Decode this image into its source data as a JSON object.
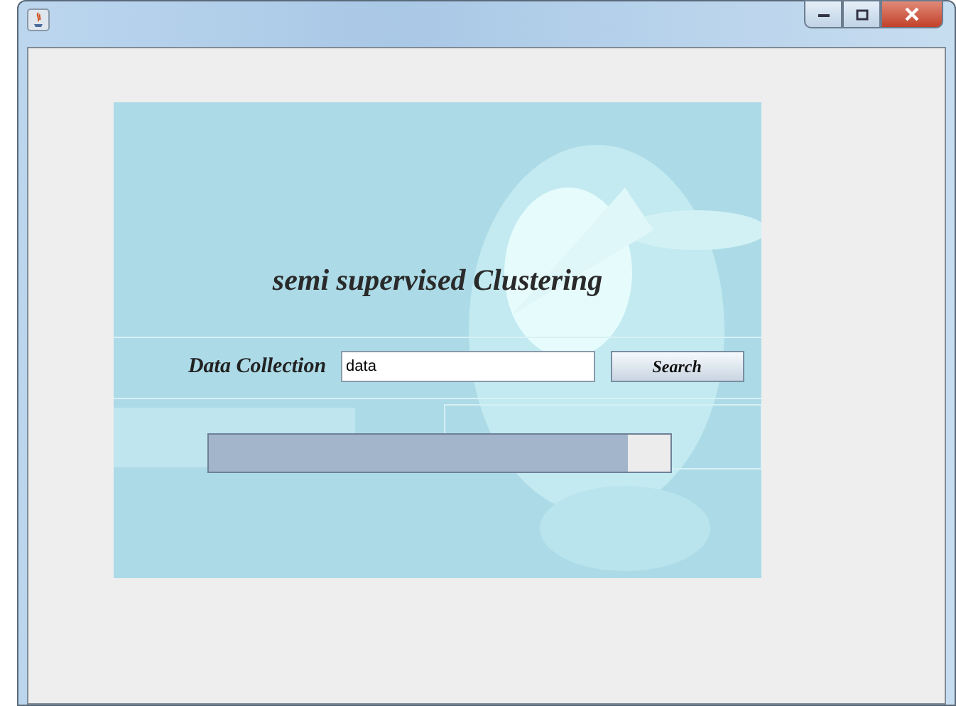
{
  "title": "semi supervised Clustering",
  "field": {
    "label": "Data Collection",
    "value": "data"
  },
  "button": "Search",
  "progress": {
    "level": 0.91
  }
}
